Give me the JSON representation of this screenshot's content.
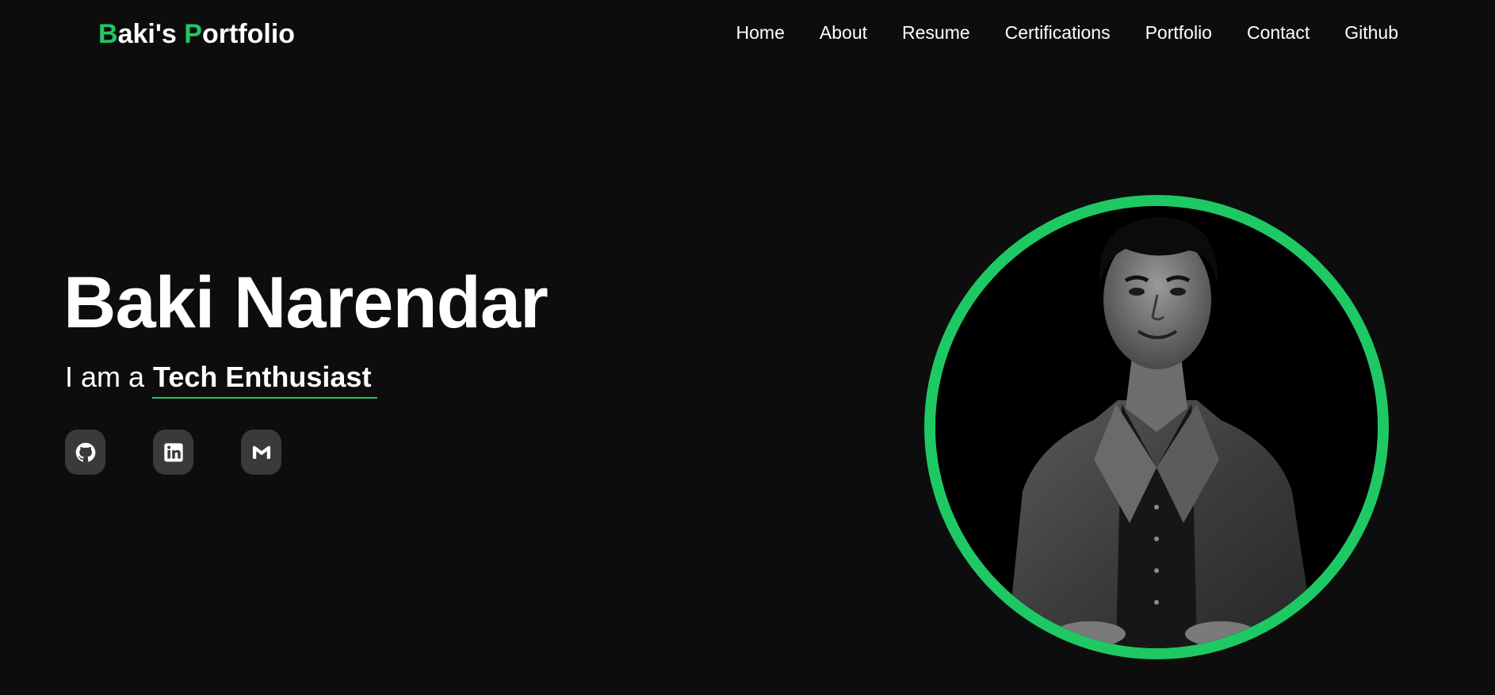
{
  "header": {
    "logo_first_initial": "B",
    "logo_first_rest": "aki's ",
    "logo_second_initial": "P",
    "logo_second_rest": "ortfolio",
    "nav": [
      {
        "label": "Home"
      },
      {
        "label": "About"
      },
      {
        "label": "Resume"
      },
      {
        "label": "Certifications"
      },
      {
        "label": "Portfolio"
      },
      {
        "label": "Contact"
      },
      {
        "label": "Github"
      }
    ]
  },
  "hero": {
    "name": "Baki Narendar",
    "tagline_prefix": "I am a ",
    "tagline_role": "Tech Enthusiast",
    "social": [
      {
        "icon": "github-icon"
      },
      {
        "icon": "linkedin-icon"
      },
      {
        "icon": "gmail-icon"
      }
    ]
  },
  "profile": {
    "image": "profile-photo"
  },
  "colors": {
    "accent": "#1ec964",
    "background": "#0d0d0d",
    "text": "#ffffff",
    "social_button_bg": "#3a3a3a"
  }
}
